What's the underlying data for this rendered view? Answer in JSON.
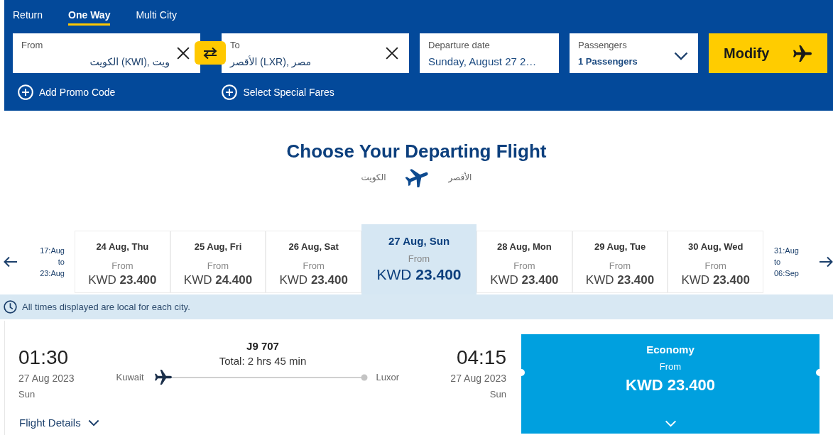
{
  "trip_tabs": [
    {
      "label": "Return",
      "selected": false
    },
    {
      "label": "One Way",
      "selected": true
    },
    {
      "label": "Multi City",
      "selected": false
    }
  ],
  "search_form": {
    "fields": [
      {
        "kind": "location",
        "label": "From",
        "value": "الكويت (KWI), ويت"
      },
      {
        "kind": "location",
        "label": "To",
        "value": "الأقصر (LXR), مصر"
      },
      {
        "kind": "date",
        "label": "Departure date",
        "value": "Sunday, August 27 2…"
      },
      {
        "kind": "select",
        "label": "Passengers",
        "value": "1 Passengers"
      }
    ],
    "submit": "Modify",
    "links": [
      "Add Promo Code",
      "Select Special Fares"
    ]
  },
  "heading": {
    "title": "Choose Your Departing Flight",
    "origin": "الكويت",
    "destination": "الأقصر"
  },
  "date_strip": {
    "previous_range": [
      "17:Aug",
      "to",
      "23:Aug"
    ],
    "days": [
      {
        "date": "24 Aug, Thu",
        "from_label": "From",
        "currency": "KWD",
        "amount": "23.400",
        "selected": false
      },
      {
        "date": "25 Aug, Fri",
        "from_label": "From",
        "currency": "KWD",
        "amount": "24.400",
        "selected": false
      },
      {
        "date": "26 Aug, Sat",
        "from_label": "From",
        "currency": "KWD",
        "amount": "23.400",
        "selected": false
      },
      {
        "date": "27 Aug, Sun",
        "from_label": "From",
        "currency": "KWD",
        "amount": "23.400",
        "selected": true
      },
      {
        "date": "28 Aug, Mon",
        "from_label": "From",
        "currency": "KWD",
        "amount": "23.400",
        "selected": false
      },
      {
        "date": "29 Aug, Tue",
        "from_label": "From",
        "currency": "KWD",
        "amount": "23.400",
        "selected": false
      },
      {
        "date": "30 Aug, Wed",
        "from_label": "From",
        "currency": "KWD",
        "amount": "23.400",
        "selected": false
      }
    ],
    "next_range": [
      "31:Aug",
      "to",
      "06:Sep"
    ]
  },
  "notice": "All times displayed are local for each city.",
  "flight": {
    "departure": {
      "time": "01:30",
      "date": "27 Aug 2023",
      "day": "Sun"
    },
    "flight_number": "J9 707",
    "duration": "Total: 2 hrs 45 min",
    "origin": "Kuwait",
    "destination": "Luxor",
    "arrival": {
      "time": "04:15",
      "date": "27 Aug 2023",
      "day": "Sun"
    },
    "fare": {
      "cabin": "Economy",
      "from_label": "From",
      "price": "KWD 23.400"
    },
    "details_link": "Flight Details"
  }
}
